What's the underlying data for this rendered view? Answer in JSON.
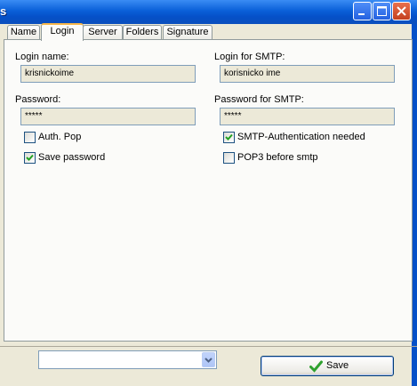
{
  "window": {
    "title_fragment": "s"
  },
  "tabs": [
    {
      "label": "Name",
      "active": false
    },
    {
      "label": "Login",
      "active": true
    },
    {
      "label": "Server",
      "active": false
    },
    {
      "label": "Folders",
      "active": false
    },
    {
      "label": "Signature",
      "active": false
    }
  ],
  "login": {
    "login_name_label": "Login name:",
    "login_name_value": "krisnickoime",
    "password_label": "Password:",
    "password_value": "*****",
    "auth_pop_label": "Auth. Pop",
    "auth_pop_checked": false,
    "save_password_label": "Save password",
    "save_password_checked": true
  },
  "smtp": {
    "login_label": "Login for SMTP:",
    "login_value": "korisnicko ime",
    "password_label": "Password for SMTP:",
    "password_value": "*****",
    "auth_needed_label": "SMTP-Authentication needed",
    "auth_needed_checked": true,
    "pop3_before_label": "POP3 before smtp",
    "pop3_before_checked": false
  },
  "footer": {
    "account_select_value": "",
    "save_label": "Save"
  },
  "icons": {
    "minimize": "minimize-icon",
    "maximize": "maximize-icon",
    "close": "close-icon",
    "save": "checkmark-icon",
    "dropdown": "chevron-down-icon"
  },
  "colors": {
    "titlebar": "#0550c8",
    "tab_highlight": "#f7b64a",
    "save_check": "#2fa12f"
  }
}
